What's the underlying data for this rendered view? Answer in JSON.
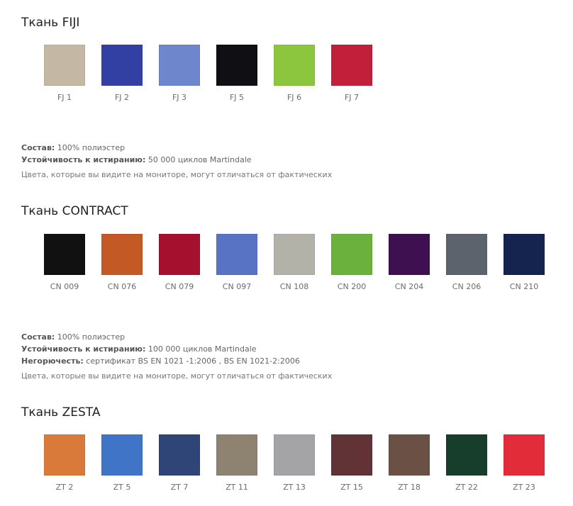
{
  "fiji": {
    "title": "Ткань FIJI",
    "swatches": [
      {
        "code": "FJ 1",
        "color": "#c4b7a3"
      },
      {
        "code": "FJ 2",
        "color": "#3340a3"
      },
      {
        "code": "FJ 3",
        "color": "#6e86cb"
      },
      {
        "code": "FJ 5",
        "color": "#0f0f14"
      },
      {
        "code": "FJ 6",
        "color": "#8cc63e"
      },
      {
        "code": "FJ 7",
        "color": "#c21f3a"
      }
    ],
    "composition_label": "Состав:",
    "composition_value": " 100% полиэстер",
    "abrasion_label": "Устойчивость к истиранию:",
    "abrasion_value": " 50 000 циклов Martindale",
    "note": "Цвета, которые вы видите на мониторе, могут отличаться от фактических"
  },
  "contract": {
    "title": "Ткань CONTRACT",
    "swatches": [
      {
        "code": "CN 009",
        "color": "#111111"
      },
      {
        "code": "CN 076",
        "color": "#c35a25"
      },
      {
        "code": "CN 079",
        "color": "#a5102e"
      },
      {
        "code": "CN 097",
        "color": "#5872c4"
      },
      {
        "code": "CN 108",
        "color": "#b2b2a8"
      },
      {
        "code": "CN 200",
        "color": "#6ab23d"
      },
      {
        "code": "CN 204",
        "color": "#3e1050"
      },
      {
        "code": "CN 206",
        "color": "#5d636c"
      },
      {
        "code": "CN 210",
        "color": "#15234f"
      }
    ],
    "composition_label": "Состав:",
    "composition_value": " 100% полиэстер",
    "abrasion_label": "Устойчивость к истиранию:",
    "abrasion_value": " 100 000 циклов Martindale",
    "fire_label": "Негорючесть:",
    "fire_value": " сертификат BS EN 1021 -1:2006 , BS EN 1021-2:2006",
    "note": "Цвета, которые вы видите на мониторе, могут отличаться от фактических"
  },
  "zesta": {
    "title": "Ткань ZESTA",
    "swatches": [
      {
        "code": "ZT 2",
        "color": "#d97a3a"
      },
      {
        "code": "ZT 5",
        "color": "#3f74c7"
      },
      {
        "code": "ZT 7",
        "color": "#2f4577"
      },
      {
        "code": "ZT 11",
        "color": "#8e8270"
      },
      {
        "code": "ZT 13",
        "color": "#a4a4a6"
      },
      {
        "code": "ZT 15",
        "color": "#613337"
      },
      {
        "code": "ZT 18",
        "color": "#6a5045"
      },
      {
        "code": "ZT 22",
        "color": "#173e2d"
      },
      {
        "code": "ZT 23",
        "color": "#e32c3a"
      }
    ]
  }
}
